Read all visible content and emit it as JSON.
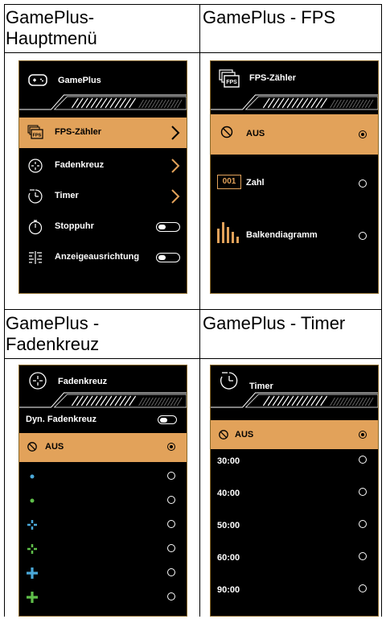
{
  "cells": {
    "main": {
      "caption": "GamePlus-\nHauptmenü"
    },
    "fps": {
      "caption": "GamePlus - FPS"
    },
    "fadenkreuz": {
      "caption": "GamePlus -\nFadenkreuz"
    },
    "timer": {
      "caption": "GamePlus - Timer"
    }
  },
  "main_menu": {
    "title": "GamePlus",
    "items": [
      {
        "label": "FPS-Zähler",
        "icon": "fps-icon",
        "control": "chevron",
        "selected": true
      },
      {
        "label": "Fadenkreuz",
        "icon": "crosshair-icon",
        "control": "chevron",
        "selected": false
      },
      {
        "label": "Timer",
        "icon": "timer-icon",
        "control": "chevron",
        "selected": false
      },
      {
        "label": "Stoppuhr",
        "icon": "stopwatch-icon",
        "control": "toggle",
        "selected": false
      },
      {
        "label": "Anzeigeausrichtung",
        "icon": "display-alignment-icon",
        "control": "toggle",
        "selected": false
      }
    ],
    "fps_badge": "FPS"
  },
  "fps_menu": {
    "title": "FPS-Zähler",
    "badge": "FPS",
    "items": [
      {
        "label": "AUS",
        "selected": true
      },
      {
        "label": "Zahl",
        "selected": false,
        "number_badge": "001"
      },
      {
        "label": "Balkendiagramm",
        "selected": false
      }
    ]
  },
  "crosshair_menu": {
    "title": "Fadenkreuz",
    "dyn_label": "Dyn. Fadenkreuz",
    "off_label": "AUS",
    "options": [
      {
        "style": "dot",
        "color": "#4aa8d8"
      },
      {
        "style": "dot",
        "color": "#5fbf4a"
      },
      {
        "style": "small-cross",
        "color": "#4aa8d8"
      },
      {
        "style": "small-cross",
        "color": "#5fbf4a"
      },
      {
        "style": "big-cross",
        "color": "#4aa8d8"
      },
      {
        "style": "big-cross",
        "color": "#5fbf4a"
      }
    ]
  },
  "timer_menu": {
    "title": "Timer",
    "off_label": "AUS",
    "times": [
      "30:00",
      "40:00",
      "50:00",
      "60:00",
      "90:00"
    ]
  },
  "colors": {
    "accent": "#e2a25a",
    "frame": "#8a6a2a",
    "panel": "#000000"
  }
}
